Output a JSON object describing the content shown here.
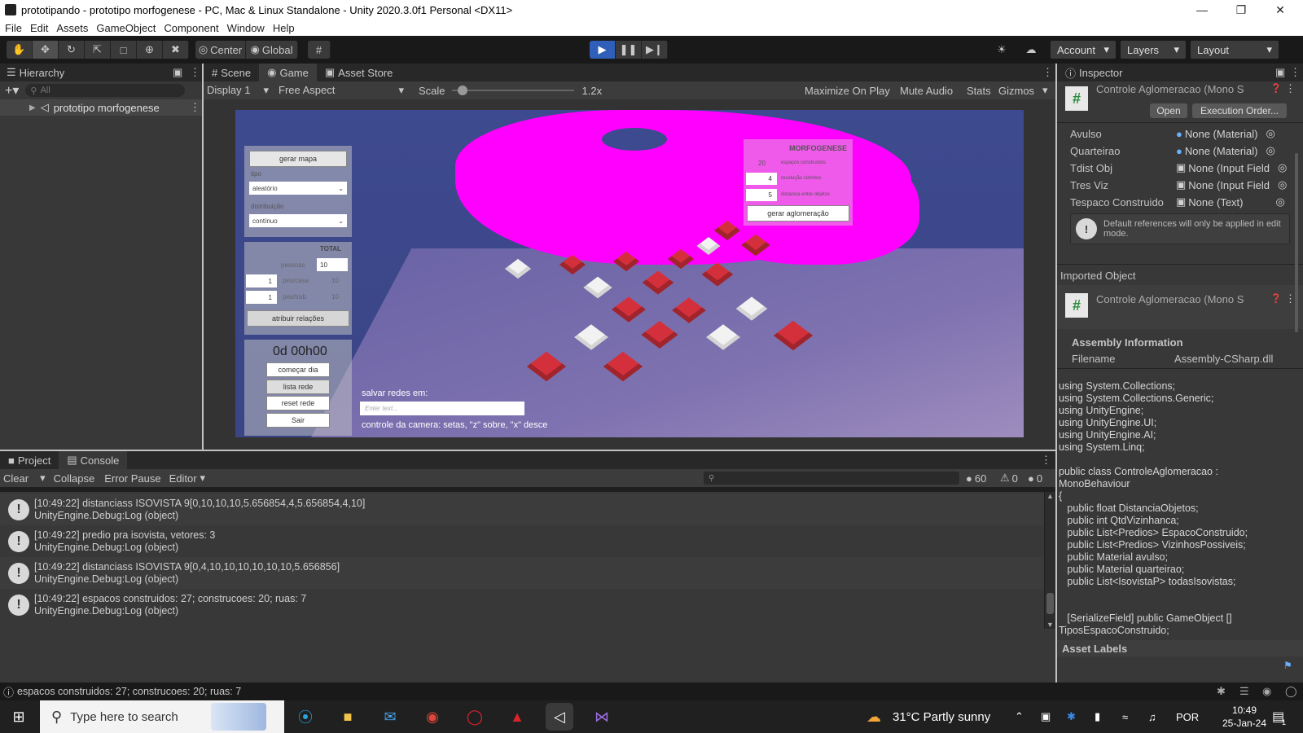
{
  "window": {
    "title": "prototipando - prototipo morfogenese - PC, Mac & Linux Standalone - Unity 2020.3.0f1 Personal <DX11>"
  },
  "menu": [
    "File",
    "Edit",
    "Assets",
    "GameObject",
    "Component",
    "Window",
    "Help"
  ],
  "toolbar": {
    "center": "Center",
    "global": "Global",
    "account": "Account",
    "layers": "Layers",
    "layout": "Layout"
  },
  "hierarchy": {
    "title": "Hierarchy",
    "search_placeholder": "All",
    "scene": "prototipo morfogenese"
  },
  "game_view": {
    "tabs": [
      "Scene",
      "Game",
      "Asset Store"
    ],
    "display": "Display 1",
    "aspect": "Free Aspect",
    "scale_label": "Scale",
    "scale_value": "1.2x",
    "scale_fraction": 0.05,
    "options": [
      "Maximize On Play",
      "Mute Audio",
      "Stats",
      "Gizmos"
    ]
  },
  "game_ui": {
    "gerar_mapa": "gerar mapa",
    "tipo_label": "tipo",
    "tipo_value": "aleatório",
    "distribuicao_label": "distribuição",
    "distribuicao_value": "contínuo",
    "total_label": "TOTAL",
    "pessoas_label": "pessoas",
    "pessoas_value": "10",
    "pescasa_input": "1",
    "pescasa_label": "pes/casa",
    "pescasa_value": "10",
    "pestrab_input": "1",
    "pestrab_label": "pes/trab",
    "pestrab_value": "10",
    "atribuir": "atribuir relações",
    "clock": "0d 00h00",
    "comecar_dia": "começar dia",
    "lista_rede": "lista rede",
    "reset_rede": "reset rede",
    "sair": "Sair",
    "salvar_label": "salvar redes em:",
    "salvar_placeholder": "Enter text...",
    "camera_hint": "controle da camera: setas, \"z\" sobre, \"x\" desce",
    "morfo_title": "MORFOGENESE",
    "espacos_value": "20",
    "espacos_label": "espaços construídos",
    "resolucao_value": "4",
    "resolucao_label": "resolução vizinhos",
    "distancia_value": "5",
    "distancia_label": "distancia entre objetos",
    "gerar_aglomeracao": "gerar aglomeração"
  },
  "inspector": {
    "title": "Inspector",
    "component": "Controle Aglomeracao (Mono S",
    "open": "Open",
    "execution_order": "Execution Order...",
    "fields": [
      {
        "key": "Avulso",
        "value": "None (Material)",
        "icon": "material-icon"
      },
      {
        "key": "Quarteirao",
        "value": "None (Material)",
        "icon": "material-icon"
      },
      {
        "key": "Tdist Obj",
        "value": "None (Input Field",
        "icon": "input-field-icon"
      },
      {
        "key": "Tres Viz",
        "value": "None (Input Field",
        "icon": "input-field-icon"
      },
      {
        "key": "Tespaco Construido",
        "value": "None (Text)",
        "icon": "text-icon"
      }
    ],
    "warning": "Default references will only be applied in edit mode.",
    "imported_object": "Imported Object",
    "imported_component": "Controle Aglomeracao (Mono S",
    "assembly_info": "Assembly Information",
    "filename_label": "Filename",
    "filename_value": "Assembly-CSharp.dll",
    "code": "using System.Collections;\nusing System.Collections.Generic;\nusing UnityEngine;\nusing UnityEngine.UI;\nusing UnityEngine.AI;\nusing System.Linq;\n\npublic class ControleAglomeracao :\nMonoBehaviour\n{\n   public float DistanciaObjetos;\n   public int QtdVizinhanca;\n   public List<Predios> EspacoConstruido;\n   public List<Predios> VizinhosPossiveis;\n   public Material avulso;\n   public Material quarteirao;\n   public List<IsovistaP> todasIsovistas;\n\n\n   [SerializeField] public GameObject []\nTiposEspacoConstruido;",
    "asset_labels": "Asset Labels"
  },
  "bottom": {
    "tabs": [
      "Project",
      "Console"
    ],
    "clear": "Clear",
    "collapse": "Collapse",
    "error_pause": "Error Pause",
    "editor": "Editor",
    "count_logs": "60",
    "count_warnings": "0",
    "count_errors": "0",
    "logs": [
      {
        "line1": "[10:49:22] distanciass ISOVISTA 9[0,10,10,10,5.656854,4,5.656854,4,10]",
        "line2": "UnityEngine.Debug:Log (object)"
      },
      {
        "line1": "[10:49:22] predio pra isovista, vetores: 3",
        "line2": "UnityEngine.Debug:Log (object)"
      },
      {
        "line1": "[10:49:22] distanciass ISOVISTA 9[0,4,10,10,10,10,10,10,5.656856]",
        "line2": "UnityEngine.Debug:Log (object)"
      },
      {
        "line1": "[10:49:22] espacos construidos: 27; construcoes: 20; ruas: 7",
        "line2": "UnityEngine.Debug:Log (object)"
      }
    ]
  },
  "status_bar": "espacos construidos: 27; construcoes: 20; ruas: 7",
  "taskbar": {
    "search_placeholder": "Type here to search",
    "weather": "31°C  Partly sunny",
    "lang": "POR",
    "time": "10:49",
    "date": "25-Jan-24",
    "notif_count": "1"
  },
  "colors": {
    "editor_bg": "#383838",
    "magenta": "#ff00ff",
    "sky": "#3d4c8c",
    "play_blue": "#2f5fb8"
  }
}
